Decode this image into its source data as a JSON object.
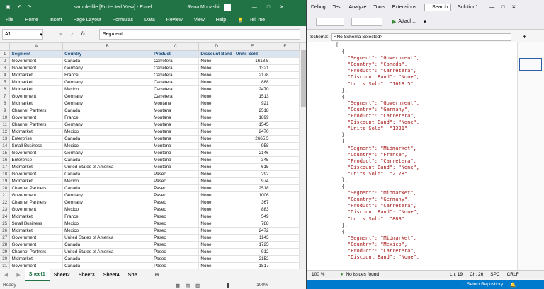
{
  "excel": {
    "title": "sample-file [Protected View] - Excel",
    "user": "Rana Mubashir",
    "menu": [
      "File",
      "Home",
      "Insert",
      "Page Layout",
      "Formulas",
      "Data",
      "Review",
      "View",
      "Help",
      "Tell me"
    ],
    "name_box": "A1",
    "formula": "Segment",
    "columns": [
      "A",
      "B",
      "C",
      "D",
      "E",
      "F"
    ],
    "rows": [
      [
        "Segment",
        "Country",
        "Product",
        "Discount Band",
        "Units Sold"
      ],
      [
        "Government",
        "Canada",
        "Carretera",
        "None",
        "1618.5"
      ],
      [
        "Government",
        "Germany",
        "Carretera",
        "None",
        "1321"
      ],
      [
        "Midmarket",
        "France",
        "Carretera",
        "None",
        "2178"
      ],
      [
        "Midmarket",
        "Germany",
        "Carretera",
        "None",
        "888"
      ],
      [
        "Midmarket",
        "Mexico",
        "Carretera",
        "None",
        "2470"
      ],
      [
        "Government",
        "Germany",
        "Carretera",
        "None",
        "1513"
      ],
      [
        "Midmarket",
        "Germany",
        "Montana",
        "None",
        "921"
      ],
      [
        "Channel Partners",
        "Canada",
        "Montana",
        "None",
        "2518"
      ],
      [
        "Government",
        "France",
        "Montana",
        "None",
        "1899"
      ],
      [
        "Channel Partners",
        "Germany",
        "Montana",
        "None",
        "1545"
      ],
      [
        "Midmarket",
        "Mexico",
        "Montana",
        "None",
        "2470"
      ],
      [
        "Enterprise",
        "Canada",
        "Montana",
        "None",
        "2665.5"
      ],
      [
        "Small Business",
        "Mexico",
        "Montana",
        "None",
        "958"
      ],
      [
        "Government",
        "Germany",
        "Montana",
        "None",
        "2146"
      ],
      [
        "Enterprise",
        "Canada",
        "Montana",
        "None",
        "345"
      ],
      [
        "Midmarket",
        "United States of America",
        "Montana",
        "None",
        "615"
      ],
      [
        "Government",
        "Canada",
        "Paseo",
        "None",
        "292"
      ],
      [
        "Midmarket",
        "Mexico",
        "Paseo",
        "None",
        "974"
      ],
      [
        "Channel Partners",
        "Canada",
        "Paseo",
        "None",
        "2518"
      ],
      [
        "Government",
        "Germany",
        "Paseo",
        "None",
        "1006"
      ],
      [
        "Channel Partners",
        "Germany",
        "Paseo",
        "None",
        "367"
      ],
      [
        "Government",
        "Mexico",
        "Paseo",
        "None",
        "883"
      ],
      [
        "Midmarket",
        "France",
        "Paseo",
        "None",
        "549"
      ],
      [
        "Small Business",
        "Mexico",
        "Paseo",
        "None",
        "788"
      ],
      [
        "Midmarket",
        "Mexico",
        "Paseo",
        "None",
        "2472"
      ],
      [
        "Government",
        "United States of America",
        "Paseo",
        "None",
        "1143"
      ],
      [
        "Government",
        "Canada",
        "Paseo",
        "None",
        "1725"
      ],
      [
        "Channel Partners",
        "United States of America",
        "Paseo",
        "None",
        "912"
      ],
      [
        "Midmarket",
        "Canada",
        "Paseo",
        "None",
        "2152"
      ],
      [
        "Government",
        "Canada",
        "Paseo",
        "None",
        "1817"
      ]
    ],
    "sheets": [
      "Sheet1",
      "Sheet2",
      "Sheet3",
      "Sheet4",
      "She"
    ],
    "status": "Ready",
    "zoom": "100%"
  },
  "vs": {
    "menu": [
      "Debug",
      "Test",
      "Analyze",
      "Tools",
      "Extensions"
    ],
    "search": "Search...",
    "solution": "Solution1",
    "attach": "Attach...",
    "schema_label": "Schema:",
    "schema_value": "<No Schema Selected>",
    "json_lines": [
      "[",
      "  {",
      "    \"Segment\": \"Government\",",
      "    \"Country\": \"Canada\",",
      "    \"Product\": \"Carretera\",",
      "    \"Discount Band\": \"None\",",
      "    \"Units Sold\": \"1618.5\"",
      "  },",
      "  {",
      "    \"Segment\": \"Government\",",
      "    \"Country\": \"Germany\",",
      "    \"Product\": \"Carretera\",",
      "    \"Discount Band\": \"None\",",
      "    \"Units Sold\": \"1321\"",
      "  },",
      "  {",
      "    \"Segment\": \"Midmarket\",",
      "    \"Country\": \"France\",",
      "    \"Product\": \"Carretera\",",
      "    \"Discount Band\": \"None\",",
      "    \"Units Sold\": \"2178\"",
      "  },",
      "  {",
      "    \"Segment\": \"Midmarket\",",
      "    \"Country\": \"Germany\",",
      "    \"Product\": \"Carretera\",",
      "    \"Discount Band\": \"None\",",
      "    \"Units Sold\": \"888\"",
      "  },",
      "  {",
      "    \"Segment\": \"Midmarket\",",
      "    \"Country\": \"Mexico\",",
      "    \"Product\": \"Carretera\",",
      "    \"Discount Band\": \"None\","
    ],
    "zoom": "100 %",
    "issues": "No issues found",
    "ln": "Ln: 19",
    "ch": "Ch: 26",
    "spc": "SPC",
    "crlf": "CRLF",
    "repo": "Select Repository"
  }
}
